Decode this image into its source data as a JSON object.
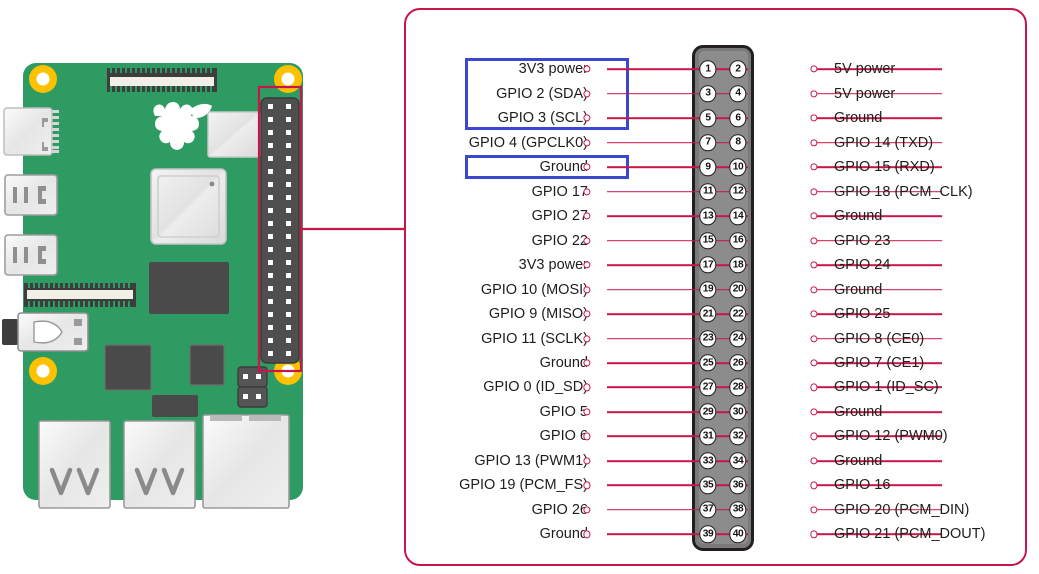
{
  "diagram": {
    "title": "Raspberry Pi 40-pin GPIO header pinout",
    "colors": {
      "frame": "#c9164a",
      "wire": "#c9164a",
      "highlight": "#3b47cc",
      "header_body": "#7a7a7a",
      "header_outline": "#231f20",
      "pcb_green": "#2e9b63",
      "mounting_hole": "#fdc100",
      "component_light": "#e8e8e8",
      "component_dark": "#4a4a4a",
      "label_text": "#1d1d1b"
    }
  },
  "board": {
    "name": "raspberry-pi-board",
    "logo": "raspberry-logo",
    "components": [
      "display-connector-ribbon",
      "usb-c-power-port",
      "micro-hdmi-port-0",
      "micro-hdmi-port-1",
      "camera-connector-ribbon",
      "audio-jack",
      "soc-chip",
      "ram-chip",
      "wifi-module",
      "ethernet-chip",
      "usb-controller-chip",
      "poe-header",
      "usb-2-ports",
      "usb-3-ports",
      "ethernet-port",
      "gpio-header-40pin"
    ]
  },
  "callout": {
    "name": "gpio-header-callout",
    "label": ""
  },
  "header": {
    "pin_count": 40,
    "rows": 20,
    "columns": 2
  },
  "highlights": [
    {
      "name": "i2c-power-highlight",
      "from_row": 1,
      "to_row": 3
    },
    {
      "name": "ground-highlight",
      "from_row": 5,
      "to_row": 5
    }
  ],
  "pins": [
    {
      "row": 1,
      "odd": 1,
      "even": 2,
      "left": "3V3 power",
      "right": "5V power"
    },
    {
      "row": 2,
      "odd": 3,
      "even": 4,
      "left": "GPIO 2 (SDA)",
      "right": "5V power"
    },
    {
      "row": 3,
      "odd": 5,
      "even": 6,
      "left": "GPIO 3 (SCL)",
      "right": "Ground"
    },
    {
      "row": 4,
      "odd": 7,
      "even": 8,
      "left": "GPIO 4 (GPCLK0)",
      "right": "GPIO 14 (TXD)"
    },
    {
      "row": 5,
      "odd": 9,
      "even": 10,
      "left": "Ground",
      "right": "GPIO 15 (RXD)"
    },
    {
      "row": 6,
      "odd": 11,
      "even": 12,
      "left": "GPIO 17",
      "right": "GPIO 18 (PCM_CLK)"
    },
    {
      "row": 7,
      "odd": 13,
      "even": 14,
      "left": "GPIO 27",
      "right": "Ground"
    },
    {
      "row": 8,
      "odd": 15,
      "even": 16,
      "left": "GPIO 22",
      "right": "GPIO 23"
    },
    {
      "row": 9,
      "odd": 17,
      "even": 18,
      "left": "3V3 power",
      "right": "GPIO 24"
    },
    {
      "row": 10,
      "odd": 19,
      "even": 20,
      "left": "GPIO 10 (MOSI)",
      "right": "Ground"
    },
    {
      "row": 11,
      "odd": 21,
      "even": 22,
      "left": "GPIO 9 (MISO)",
      "right": "GPIO 25"
    },
    {
      "row": 12,
      "odd": 23,
      "even": 24,
      "left": "GPIO 11 (SCLK)",
      "right": "GPIO 8 (CE0)"
    },
    {
      "row": 13,
      "odd": 25,
      "even": 26,
      "left": "Ground",
      "right": "GPIO 7 (CE1)"
    },
    {
      "row": 14,
      "odd": 27,
      "even": 28,
      "left": "GPIO 0 (ID_SD)",
      "right": "GPIO 1 (ID_SC)"
    },
    {
      "row": 15,
      "odd": 29,
      "even": 30,
      "left": "GPIO 5",
      "right": "Ground"
    },
    {
      "row": 16,
      "odd": 31,
      "even": 32,
      "left": "GPIO 6",
      "right": "GPIO 12 (PWM0)"
    },
    {
      "row": 17,
      "odd": 33,
      "even": 34,
      "left": "GPIO 13 (PWM1)",
      "right": "Ground"
    },
    {
      "row": 18,
      "odd": 35,
      "even": 36,
      "left": "GPIO 19 (PCM_FS)",
      "right": "GPIO 16"
    },
    {
      "row": 19,
      "odd": 37,
      "even": 38,
      "left": "GPIO 26",
      "right": "GPIO 20 (PCM_DIN)"
    },
    {
      "row": 20,
      "odd": 39,
      "even": 40,
      "left": "Ground",
      "right": "GPIO 21 (PCM_DOUT)"
    }
  ]
}
